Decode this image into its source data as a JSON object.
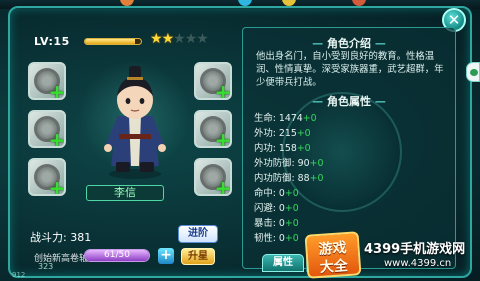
{
  "level": {
    "label": "LV:15",
    "exp_fraction": 0.9
  },
  "stars": {
    "filled": 2,
    "total": 5
  },
  "hero": {
    "name": "李信"
  },
  "power": {
    "text": "战斗力: 381"
  },
  "buttons": {
    "upgrade": "进阶",
    "star_up": "升星",
    "add": "+"
  },
  "fragments": {
    "label": "创始新高卷轴",
    "current": 61,
    "max": 50,
    "text": "61/50"
  },
  "misc_numbers": {
    "a": "323",
    "b": "912"
  },
  "description": {
    "title": "角色介绍",
    "text": "他出身名门，自小受到良好的教育。性格温润、性情真挚。深受家族器重，武艺超群，年少便带兵打战。"
  },
  "attributes": {
    "title": "角色属性",
    "rows": [
      {
        "label": "生命:",
        "value": "1474",
        "bonus": "+0"
      },
      {
        "label": "外功:",
        "value": "215",
        "bonus": "+0"
      },
      {
        "label": "内功:",
        "value": "158",
        "bonus": "+0"
      },
      {
        "label": "外功防御:",
        "value": "90",
        "bonus": "+0"
      },
      {
        "label": "内功防御:",
        "value": "88",
        "bonus": "+0"
      },
      {
        "label": "命中:",
        "value": "0",
        "bonus": "+0"
      },
      {
        "label": "闪避:",
        "value": "0",
        "bonus": "+0"
      },
      {
        "label": "暴击:",
        "value": "0",
        "bonus": "+0"
      },
      {
        "label": "韧性:",
        "value": "0",
        "bonus": "+0"
      }
    ]
  },
  "tabs": {
    "attributes": "属性"
  },
  "watermark": {
    "logo_line1": "游戏",
    "logo_line2": "大全",
    "site": "4399手机游戏网",
    "url": "www.4399.cn"
  },
  "icons": {
    "close": "close-icon",
    "plus": "plus-icon",
    "star": "star-icon"
  }
}
